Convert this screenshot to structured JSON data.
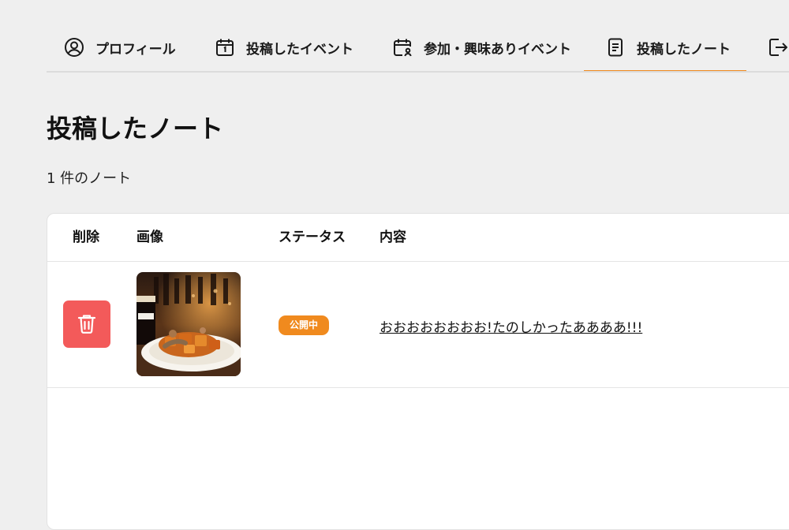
{
  "tabs": [
    {
      "label": "プロフィール",
      "icon": "user-circle-icon"
    },
    {
      "label": "投稿したイベント",
      "icon": "calendar-icon"
    },
    {
      "label": "参加・興味ありイベント",
      "icon": "calendar-user-icon"
    },
    {
      "label": "投稿したノート",
      "icon": "document-icon",
      "active": true
    },
    {
      "label": "",
      "icon": "logout-icon"
    }
  ],
  "page": {
    "title": "投稿したノート",
    "count": "1 件のノート"
  },
  "table": {
    "headers": [
      "削除",
      "画像",
      "ステータス",
      "内容"
    ],
    "rows": [
      {
        "delete_icon": "trash-icon",
        "image": "food-photo",
        "status": "公開中",
        "content": "おおおおおおおお!たのしかったああああ!!!"
      }
    ]
  },
  "colors": {
    "accent": "#f08a1e",
    "delete": "#f35a5a",
    "background": "#efefef"
  }
}
